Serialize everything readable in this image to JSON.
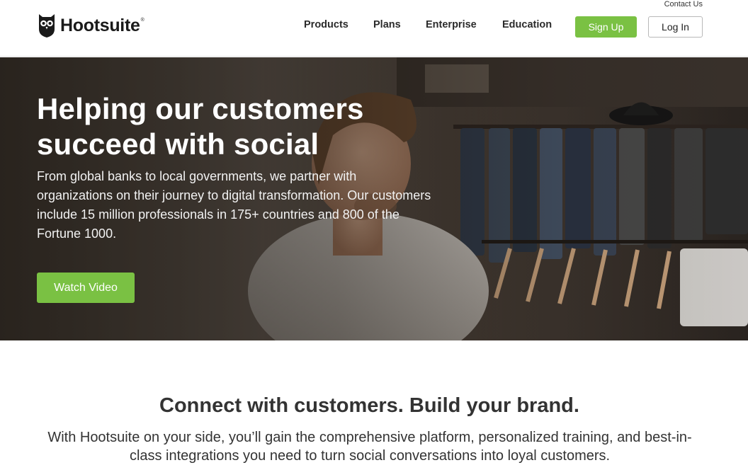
{
  "header": {
    "contact_label": "Contact Us",
    "logo_text": "Hootsuite",
    "logo_mark": "®",
    "nav": [
      {
        "label": "Products"
      },
      {
        "label": "Plans"
      },
      {
        "label": "Enterprise"
      },
      {
        "label": "Education"
      }
    ],
    "signup_label": "Sign Up",
    "login_label": "Log In"
  },
  "hero": {
    "title": "Helping our customers succeed with social",
    "description": "From global banks to local governments, we partner with organizations on their journey to digital transformation. Our customers include 15 million professionals in 175+ countries and 800 of the Fortune 1000.",
    "cta_label": "Watch Video"
  },
  "section": {
    "title": "Connect with customers. Build your brand.",
    "description": "With Hootsuite on your side, you’ll gain the comprehensive platform, personalized training, and best-in-class integrations you need to turn social conversations into loyal customers."
  },
  "colors": {
    "accent_green": "#7ac143",
    "text_dark": "#333333"
  },
  "icons": [
    "owl-logo-icon"
  ]
}
